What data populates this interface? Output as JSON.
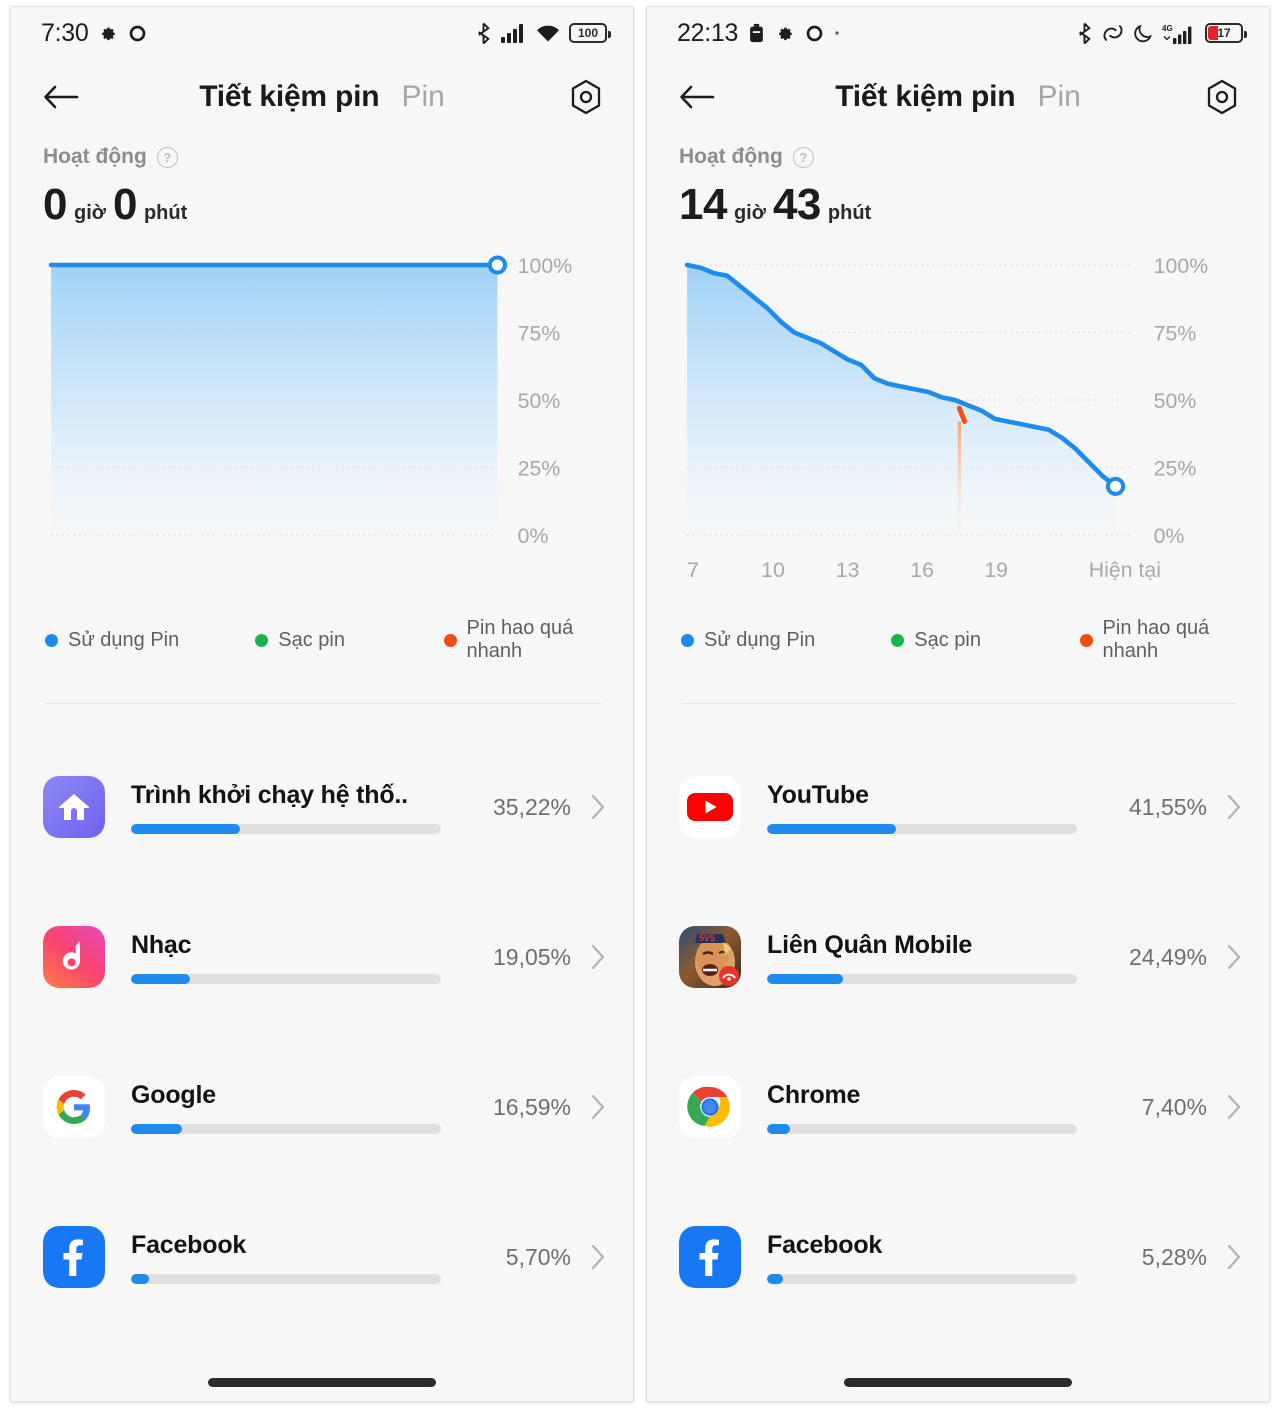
{
  "panels": [
    {
      "id": "left",
      "statusbar": {
        "time": "7:30",
        "left_icons": [
          "gear-icon",
          "circle-icon"
        ],
        "right_icons": [
          "bluetooth-icon",
          "signal-icon",
          "wifi-icon"
        ],
        "battery_level": "100",
        "battery_low": false
      },
      "appbar": {
        "back": "back-arrow-icon",
        "title": "Tiết kiệm pin",
        "tab_inactive": "Pin",
        "settings": "gear-icon"
      },
      "activity": {
        "label": "Hoạt động",
        "help": "?",
        "hours": "0",
        "hours_unit": "giờ",
        "minutes": "0",
        "minutes_unit": "phút"
      },
      "legend": [
        {
          "label": "Sử dụng Pin",
          "color": "#1e8bef"
        },
        {
          "label": "Sạc pin",
          "color": "#18b64a"
        },
        {
          "label": "Pin hao quá nhanh",
          "color": "#f04e11"
        }
      ],
      "apps": [
        {
          "icon": "launcher-icon",
          "name": "Trình khởi chạy hệ thố..",
          "percent": "35,22%",
          "bar": 35.22
        },
        {
          "icon": "music-icon",
          "name": "Nhạc",
          "percent": "19,05%",
          "bar": 19.05
        },
        {
          "icon": "google-icon",
          "name": "Google",
          "percent": "16,59%",
          "bar": 16.59
        },
        {
          "icon": "facebook-icon",
          "name": "Facebook",
          "percent": "5,70%",
          "bar": 5.7
        }
      ],
      "chart_data": {
        "type": "area",
        "title": "Battery level history",
        "ylabel": "",
        "xlabel": "",
        "ylim": [
          0,
          100
        ],
        "yticks": [
          "0%",
          "25%",
          "50%",
          "75%",
          "100%"
        ],
        "ytick_values": [
          0,
          25,
          50,
          75,
          100
        ],
        "xticks": [],
        "grid": true,
        "legend_position": "below",
        "line_color": "#1e8bef",
        "series": [
          {
            "name": "Sử dụng Pin",
            "x": [
              0,
              100
            ],
            "values": [
              100,
              100
            ]
          }
        ],
        "endpoint_marker": {
          "x": 100,
          "y": 100
        },
        "fast_drain_segments": []
      }
    },
    {
      "id": "right",
      "statusbar": {
        "time": "22:13",
        "left_icons": [
          "alarm-icon",
          "gear-icon",
          "circle-icon",
          "dot-icon"
        ],
        "right_icons": [
          "bluetooth-icon",
          "dnd-icon",
          "moon-icon",
          "signal-4g-icon"
        ],
        "battery_level": "17",
        "battery_low": true
      },
      "appbar": {
        "back": "back-arrow-icon",
        "title": "Tiết kiệm pin",
        "tab_inactive": "Pin",
        "settings": "gear-icon"
      },
      "activity": {
        "label": "Hoạt động",
        "help": "?",
        "hours": "14",
        "hours_unit": "giờ",
        "minutes": "43",
        "minutes_unit": "phút"
      },
      "legend": [
        {
          "label": "Sử dụng Pin",
          "color": "#1e8bef"
        },
        {
          "label": "Sạc pin",
          "color": "#18b64a"
        },
        {
          "label": "Pin hao quá nhanh",
          "color": "#f04e11"
        }
      ],
      "apps": [
        {
          "icon": "youtube-icon",
          "name": "YouTube",
          "percent": "41,55%",
          "bar": 41.55
        },
        {
          "icon": "lienquan-icon",
          "name": "Liên Quân Mobile",
          "percent": "24,49%",
          "bar": 24.49
        },
        {
          "icon": "chrome-icon",
          "name": "Chrome",
          "percent": "7,40%",
          "bar": 7.4
        },
        {
          "icon": "facebook-icon",
          "name": "Facebook",
          "percent": "5,28%",
          "bar": 5.28
        }
      ],
      "chart_data": {
        "type": "area",
        "title": "Battery level history",
        "ylabel": "",
        "xlabel": "",
        "ylim": [
          0,
          100
        ],
        "yticks": [
          "0%",
          "25%",
          "50%",
          "75%",
          "100%"
        ],
        "ytick_values": [
          0,
          25,
          50,
          75,
          100
        ],
        "xticks": [
          "7",
          "10",
          "13",
          "16",
          "19",
          "Hiện tại"
        ],
        "xtick_positions": [
          0,
          16.6,
          33.3,
          50,
          66.6,
          90
        ],
        "grid": true,
        "legend_position": "below",
        "line_color": "#1e8bef",
        "series": [
          {
            "name": "Sử dụng Pin",
            "x": [
              0,
              3,
              6,
              9,
              12,
              15,
              18,
              21,
              24,
              27,
              30,
              33,
              36,
              39,
              42,
              45,
              48,
              51,
              54,
              57,
              60,
              63,
              66,
              69,
              72,
              75,
              78,
              81,
              84,
              87,
              90,
              93,
              96
            ],
            "values": [
              100,
              99,
              97,
              96,
              92,
              88,
              84,
              79,
              75,
              73,
              71,
              68,
              65,
              63,
              58,
              56,
              55,
              54,
              53,
              51,
              50,
              48,
              46,
              43,
              42,
              41,
              40,
              39,
              36,
              32,
              27,
              22,
              18
            ]
          }
        ],
        "endpoint_marker": {
          "x": 96,
          "y": 18
        },
        "fast_drain_segments": [
          {
            "x": 61,
            "y_from": 47,
            "y_to": 42,
            "color": "#f04e11"
          }
        ]
      }
    }
  ]
}
